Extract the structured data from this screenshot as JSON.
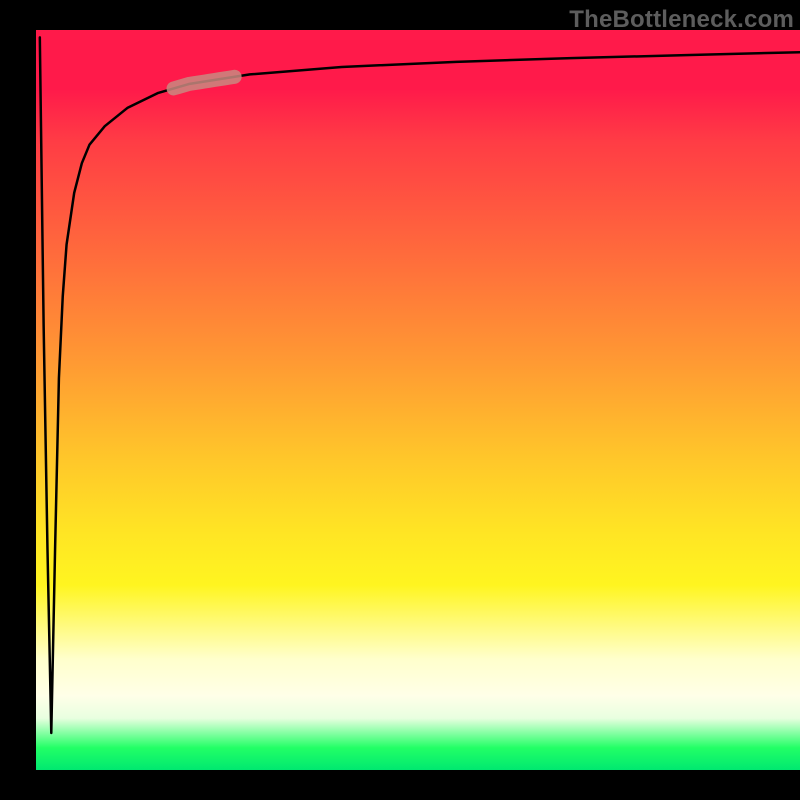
{
  "watermark": "TheBottleneck.com",
  "colors": {
    "background": "#000000",
    "curve": "#000000",
    "marker": "#c98a80",
    "watermarkText": "#5d5d5d"
  },
  "chart_data": {
    "type": "line",
    "title": "",
    "xlabel": "",
    "ylabel": "",
    "xlim": [
      0,
      100
    ],
    "ylim": [
      0,
      100
    ],
    "x": [
      0.5,
      1,
      1.5,
      2,
      2.5,
      3,
      3.5,
      4,
      5,
      6,
      7,
      9,
      12,
      16,
      20,
      28,
      40,
      55,
      70,
      85,
      100
    ],
    "values": [
      99,
      60,
      30,
      5,
      30,
      53,
      64,
      71,
      78,
      82,
      84.5,
      87,
      89.5,
      91.5,
      92.7,
      94,
      95,
      95.7,
      96.2,
      96.6,
      97
    ],
    "marker": {
      "x_range": [
        18,
        26
      ],
      "note": "highlighted segment on curve"
    },
    "annotations": []
  }
}
